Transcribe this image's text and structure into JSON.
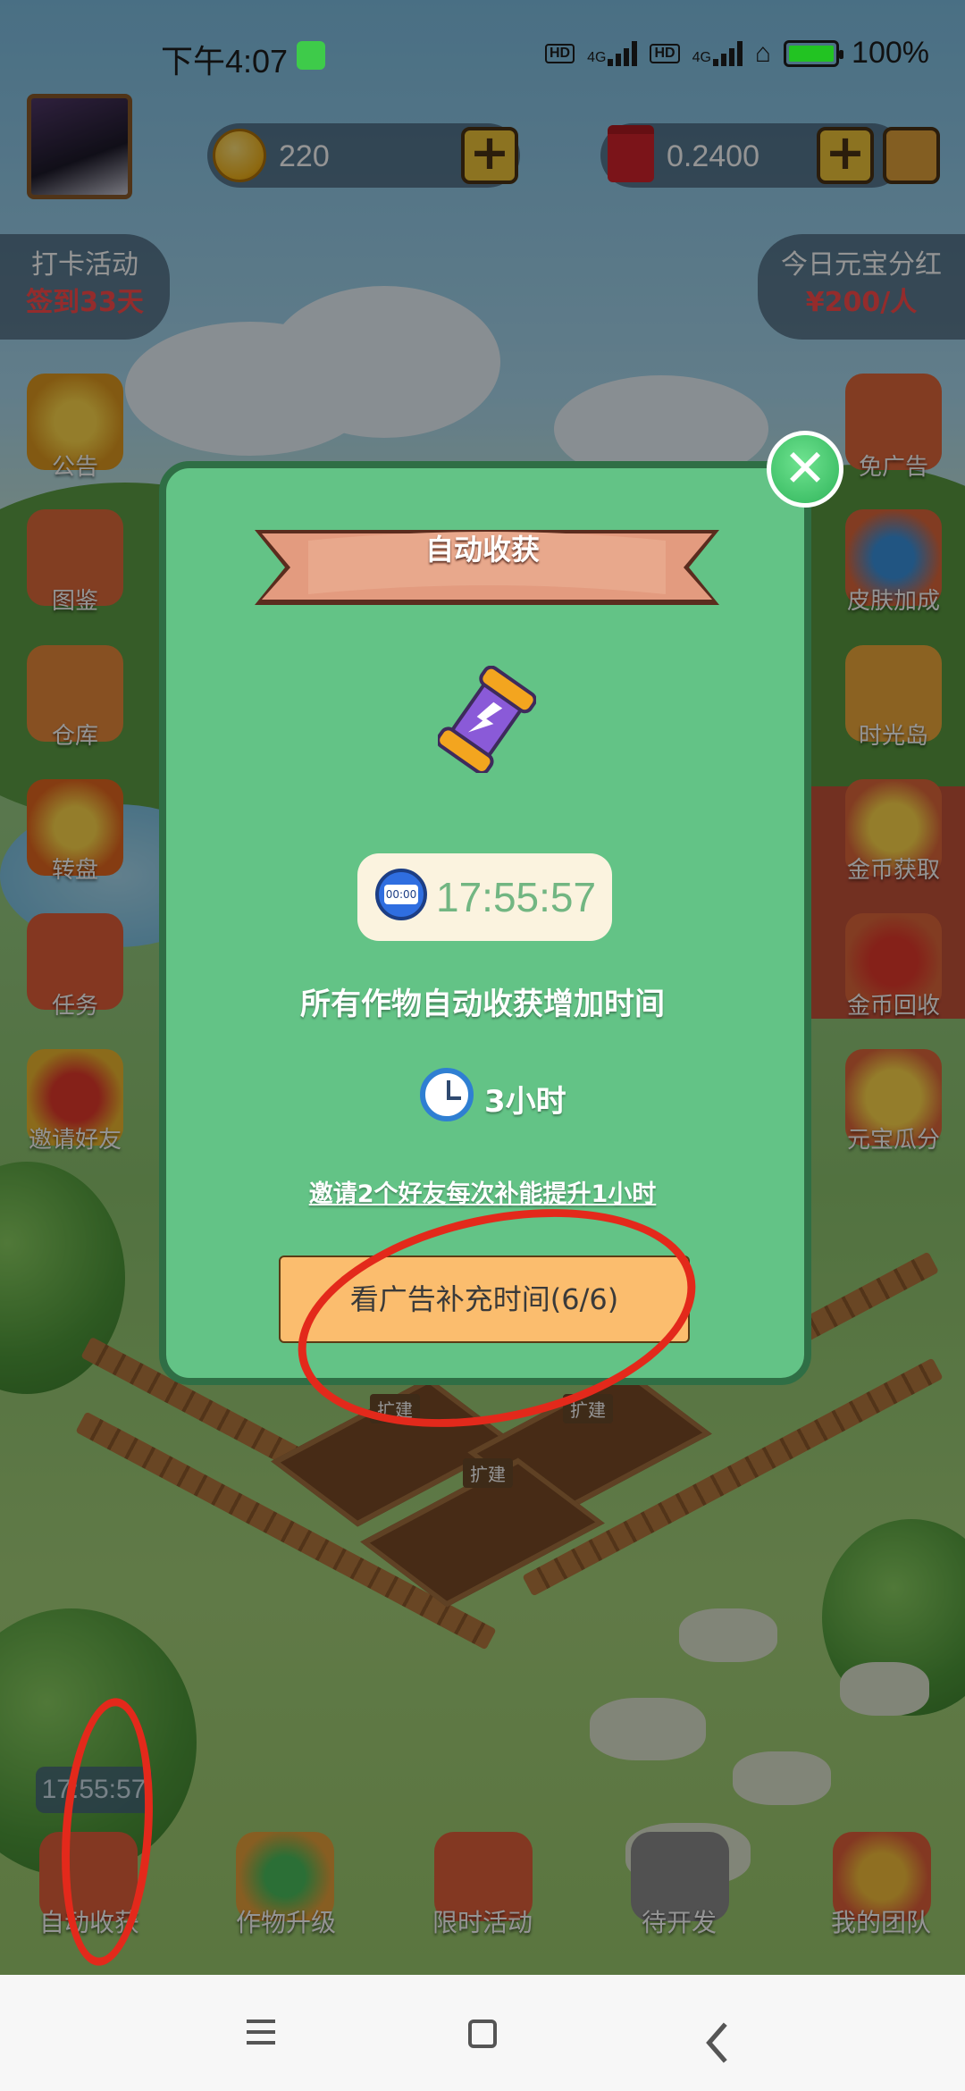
{
  "status_bar": {
    "time": "下午4:07",
    "network_1": "4G",
    "network_2": "4G",
    "hd": "HD",
    "battery": "100%"
  },
  "hud": {
    "coins": "220",
    "cash": "0.2400"
  },
  "checkin": {
    "title": "打卡活动",
    "value": "签到33天"
  },
  "dividend": {
    "title": "今日元宝分红",
    "value": "¥200/人"
  },
  "left_menu": [
    {
      "label": "公告"
    },
    {
      "label": "图鉴"
    },
    {
      "label": "仓库"
    },
    {
      "label": "转盘"
    },
    {
      "label": "任务"
    },
    {
      "label": "邀请好友"
    }
  ],
  "right_menu": [
    {
      "label": "免广告"
    },
    {
      "label": "皮肤加成"
    },
    {
      "label": "时光岛"
    },
    {
      "label": "金币获取"
    },
    {
      "label": "金币回收"
    },
    {
      "label": "元宝瓜分"
    }
  ],
  "modal": {
    "title": "自动收获",
    "timer": "17:55:57",
    "stopwatch_face": "00:00",
    "description": "所有作物自动收获增加时间",
    "hours": "3小时",
    "invite_text": "邀请2个好友每次补能提升1小时",
    "ad_button": "看广告补充时间(6/6)"
  },
  "farm_plots": [
    {
      "label": "扩建"
    },
    {
      "label": "扩建"
    },
    {
      "label": "扩建"
    }
  ],
  "bottom_bar": {
    "mini_timer": "17:55:57",
    "items": [
      {
        "label": "自动收获"
      },
      {
        "label": "作物升级"
      },
      {
        "label": "限时活动"
      },
      {
        "label": "待开发"
      },
      {
        "label": "我的团队"
      }
    ]
  },
  "colors": {
    "modal_bg": "#63c386",
    "modal_border": "#2f6e45",
    "ad_button": "#fbbd6e",
    "annotation": "#e3291b",
    "accent_red": "#ff4d4d"
  }
}
